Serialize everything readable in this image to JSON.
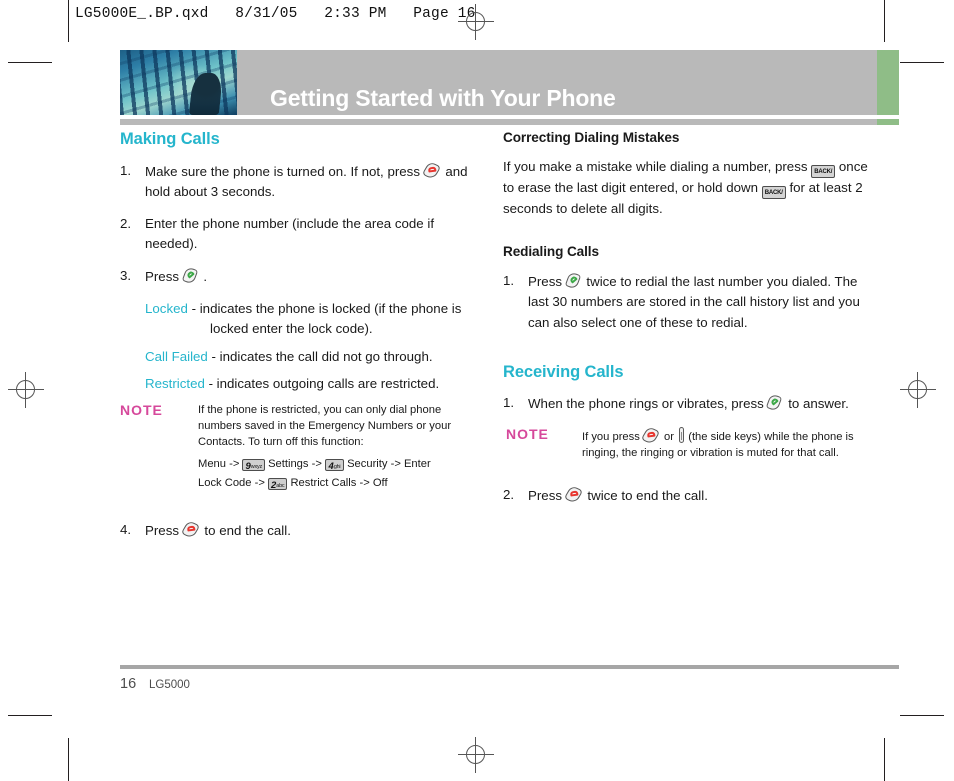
{
  "prepress": {
    "slug": "LG5000E_.BP.qxd   8/31/05   2:33 PM   Page 16"
  },
  "header": {
    "chapter_title": "Getting Started with Your Phone",
    "accent_color": "#8fbd87",
    "band_color": "#b9b9b9"
  },
  "theme": {
    "heading_color": "#25b5cc",
    "note_color": "#d6489b",
    "text_color": "#1a1a1a"
  },
  "left_column": {
    "section_title": "Making Calls",
    "steps": [
      {
        "num": "1.",
        "before": "Make sure the phone is turned on. If not, press",
        "icon": "end-key-icon",
        "after": "and hold about 3 seconds."
      },
      {
        "num": "2.",
        "before": "Enter the phone number (include the area code if needed).",
        "icon": "",
        "after": ""
      },
      {
        "num": "3.",
        "before": "Press",
        "icon": "send-key-icon",
        "after": "."
      }
    ],
    "definitions": [
      {
        "term": "Locked",
        "text": "- indicates the phone is locked (if the phone is locked enter the lock code)."
      },
      {
        "term": "Call Failed",
        "text": "- indicates the call did not go through."
      },
      {
        "term": "Restricted",
        "text": "- indicates outgoing calls are restricted."
      }
    ],
    "note": {
      "label": "NOTE",
      "body": "If the phone is restricted, you can only dial phone numbers saved in the Emergency Numbers or your Contacts. To turn off this function:",
      "path_line_1_pre": "Menu ->",
      "path_key_1_digit": "9",
      "path_key_1_letters": "wxyz",
      "path_line_1_mid": "Settings ->",
      "path_key_2_digit": "4",
      "path_key_2_letters": "ghi",
      "path_line_1_post": "Security -> Enter",
      "path_line_2_pre": "Lock Code ->",
      "path_key_3_digit": "2",
      "path_key_3_letters": "abc",
      "path_line_2_post": "Restrict Calls -> Off"
    },
    "final_step": {
      "num": "4.",
      "before": "Press",
      "icon": "end-key-icon",
      "after": "to end the call."
    }
  },
  "right_column": {
    "correcting": {
      "title": "Correcting Dialing Mistakes",
      "line_1_pre": "If you make a mistake while dialing a number, press",
      "key_1_label": "BACK/",
      "line_2_pre": "once to erase the last digit entered, or hold down",
      "key_2_label": "BACK/",
      "line_3": "for at least 2 seconds to delete all digits."
    },
    "redialing": {
      "title": "Redialing Calls",
      "step_num": "1.",
      "before": "Press",
      "icon": "send-key-icon",
      "after": "twice to redial the last number you dialed. The last 30 numbers are stored in the call history list and you can also select one of these to redial."
    },
    "receiving": {
      "section_title": "Receiving Calls",
      "step_1_num": "1.",
      "step_1_before": "When the phone rings or vibrates, press",
      "step_1_icon": "send-key-icon",
      "step_1_after": "to answer.",
      "note": {
        "label": "NOTE",
        "pre": "If you press",
        "icon_1": "end-key-icon",
        "mid": "or",
        "icon_2": "side-key-icon",
        "post": "(the side keys) while the phone is ringing, the ringing or vibration is muted for that call."
      },
      "step_2_num": "2.",
      "step_2_before": "Press",
      "step_2_icon": "end-key-icon",
      "step_2_after": "twice to end the call."
    }
  },
  "footer": {
    "page_number": "16",
    "model": "LG5000"
  }
}
